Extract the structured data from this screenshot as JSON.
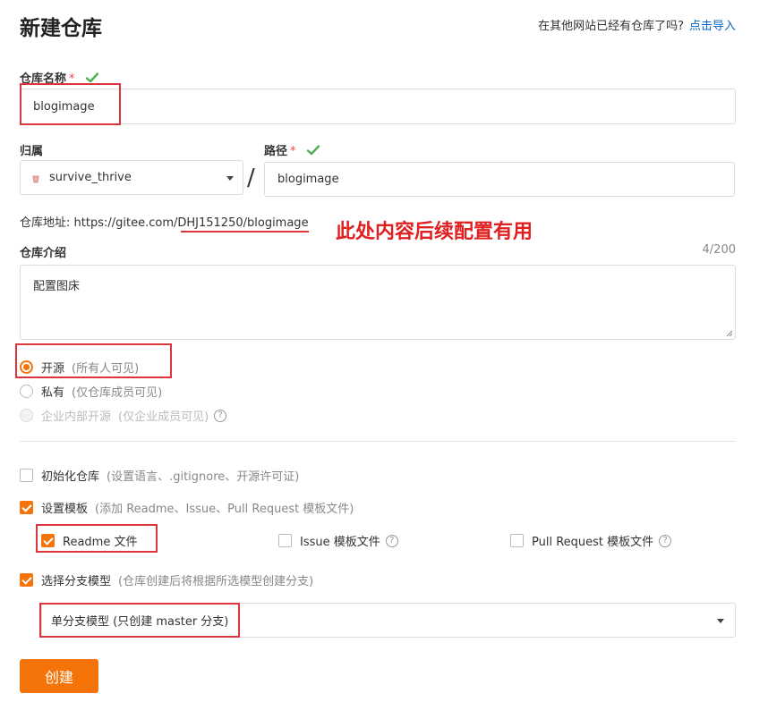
{
  "header": {
    "title": "新建仓库",
    "import_hint": "在其他网站已经有仓库了吗?",
    "import_link": "点击导入"
  },
  "repo_name": {
    "label": "仓库名称",
    "required_mark": "*",
    "value": "blogimage"
  },
  "owner": {
    "label": "归属",
    "value": "survive_thrive"
  },
  "path": {
    "separator": "/",
    "label": "路径",
    "required_mark": "*",
    "value": "blogimage"
  },
  "repo_url": {
    "label": "仓库地址:",
    "prefix": "https://gitee.com/",
    "suffix": "DHJ151250/blogimage"
  },
  "annotation": "此处内容后续配置有用",
  "description": {
    "label": "仓库介绍",
    "counter": "4/200",
    "value": "配置图床"
  },
  "visibility": {
    "options": [
      {
        "label": "开源",
        "note": "(所有人可见)",
        "selected": true
      },
      {
        "label": "私有",
        "note": "(仅仓库成员可见)",
        "selected": false
      },
      {
        "label": "企业内部开源",
        "note": "(仅企业成员可见)",
        "selected": false,
        "disabled": true
      }
    ]
  },
  "init_repo": {
    "label": "初始化仓库",
    "note": "(设置语言、.gitignore、开源许可证)",
    "checked": false
  },
  "template": {
    "label": "设置模板",
    "note": "(添加 Readme、Issue、Pull Request 模板文件)",
    "checked": true,
    "files": [
      {
        "label": "Readme 文件",
        "checked": true
      },
      {
        "label": "Issue 模板文件",
        "checked": false
      },
      {
        "label": "Pull Request 模板文件",
        "checked": false
      }
    ]
  },
  "branch_model": {
    "label": "选择分支模型",
    "note": "(仓库创建后将根据所选模型创建分支)",
    "checked": true,
    "selected": "单分支模型 (只创建 master 分支)"
  },
  "submit": {
    "label": "创建"
  },
  "colors": {
    "accent": "#f5740a",
    "annotation_red": "#e02020",
    "link": "#0a66c2",
    "check_green": "#4caf50"
  }
}
